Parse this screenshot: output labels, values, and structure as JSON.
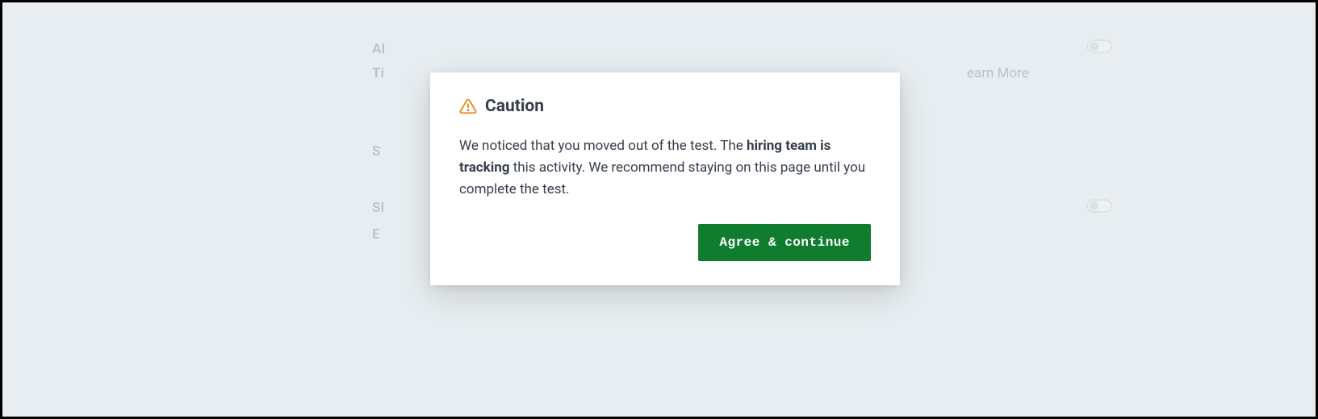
{
  "background": {
    "row1": "AI",
    "row2": "Ti",
    "row3": "S",
    "row4": "SI",
    "row5": "E",
    "link": "earn More"
  },
  "modal": {
    "title": "Caution",
    "body_prefix": "We noticed that you moved out of the test. The ",
    "body_bold": "hiring team is tracking",
    "body_suffix": " this activity. We recommend staying on this page until you complete the test.",
    "button_label": "Agree & continue"
  }
}
